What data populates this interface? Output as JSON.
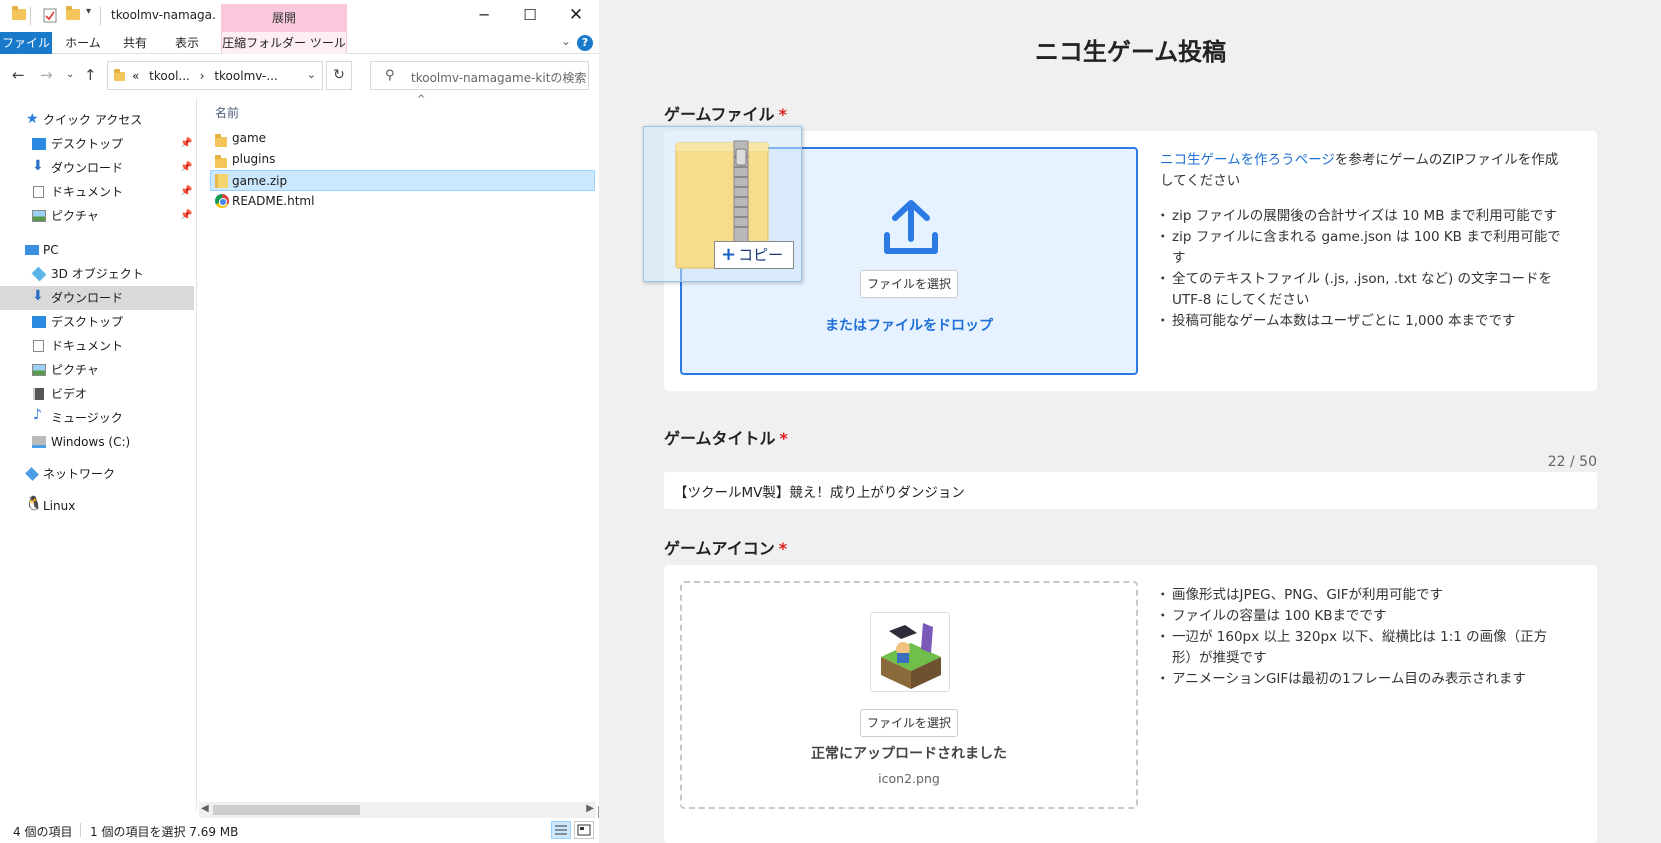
{
  "explorer": {
    "title": "tkoolmv-namaga...",
    "context_tab_header": "展開",
    "ribbon_tabs": [
      "ファイル",
      "ホーム",
      "共有",
      "表示",
      "圧縮フォルダー ツール"
    ],
    "address_prefix": "«",
    "address_parts": [
      "tkool...",
      "tkoolmv-..."
    ],
    "address_separator": "›",
    "search_placeholder": "tkoolmv-namagame-kitの検索",
    "nav": {
      "quick_access": "クイック アクセス",
      "quick_items": [
        "デスクトップ",
        "ダウンロード",
        "ドキュメント",
        "ピクチャ"
      ],
      "pc": "PC",
      "pc_items": [
        "3D オブジェクト",
        "ダウンロード",
        "デスクトップ",
        "ドキュメント",
        "ピクチャ",
        "ビデオ",
        "ミュージック",
        "Windows (C:)"
      ],
      "network": "ネットワーク",
      "linux": "Linux"
    },
    "column_header": "名前",
    "files": [
      {
        "name": "game",
        "type": "folder"
      },
      {
        "name": "plugins",
        "type": "folder"
      },
      {
        "name": "game.zip",
        "type": "zip",
        "selected": true
      },
      {
        "name": "README.html",
        "type": "chrome"
      }
    ],
    "status": {
      "item_count": "4 個の項目",
      "selection": "1 個の項目を選択  7.69 MB"
    }
  },
  "drag": {
    "badge_plus": "+",
    "badge_label": "コピー"
  },
  "page": {
    "title": "ニコ生ゲーム投稿",
    "required_mark": "*",
    "game_file": {
      "label": "ゲームファイル",
      "choose_button": "ファイルを選択",
      "drop_text": "またはファイルをドロップ",
      "intro_link": "ニコ生ゲームを作ろうページ",
      "intro_rest": "を参考にゲームのZIPファイルを作成してください",
      "bullets": [
        "zip ファイルの展開後の合計サイズは 10 MB まで利用可能です",
        "zip ファイルに含まれる game.json は 100 KB まで利用可能です",
        "全てのテキストファイル (.js, .json, .txt など) の文字コードを UTF-8 にしてください",
        "投稿可能なゲーム本数はユーザごとに 1,000 本までです"
      ]
    },
    "game_title": {
      "label": "ゲームタイトル",
      "count": "22 / 50",
      "value": "【ツクールMV製】競え！成り上がりダンジョン"
    },
    "game_icon": {
      "label": "ゲームアイコン",
      "choose_button": "ファイルを選択",
      "status": "正常にアップロードされました",
      "filename": "icon2.png",
      "bullets": [
        "画像形式はJPEG、PNG、GIFが利用可能です",
        "ファイルの容量は 100 KBまでです",
        "一辺が 160px 以上 320px 以下、縦横比は 1:1 の画像（正方形）が推奨です",
        "アニメーションGIFは最初の1フレーム目のみ表示されます"
      ]
    }
  },
  "colors": {
    "accent": "#2c7be5",
    "link": "#1f6fd6",
    "required": "#e02020",
    "ribbon_file": "#1979ca",
    "context_tab": "#f9c8dc"
  }
}
